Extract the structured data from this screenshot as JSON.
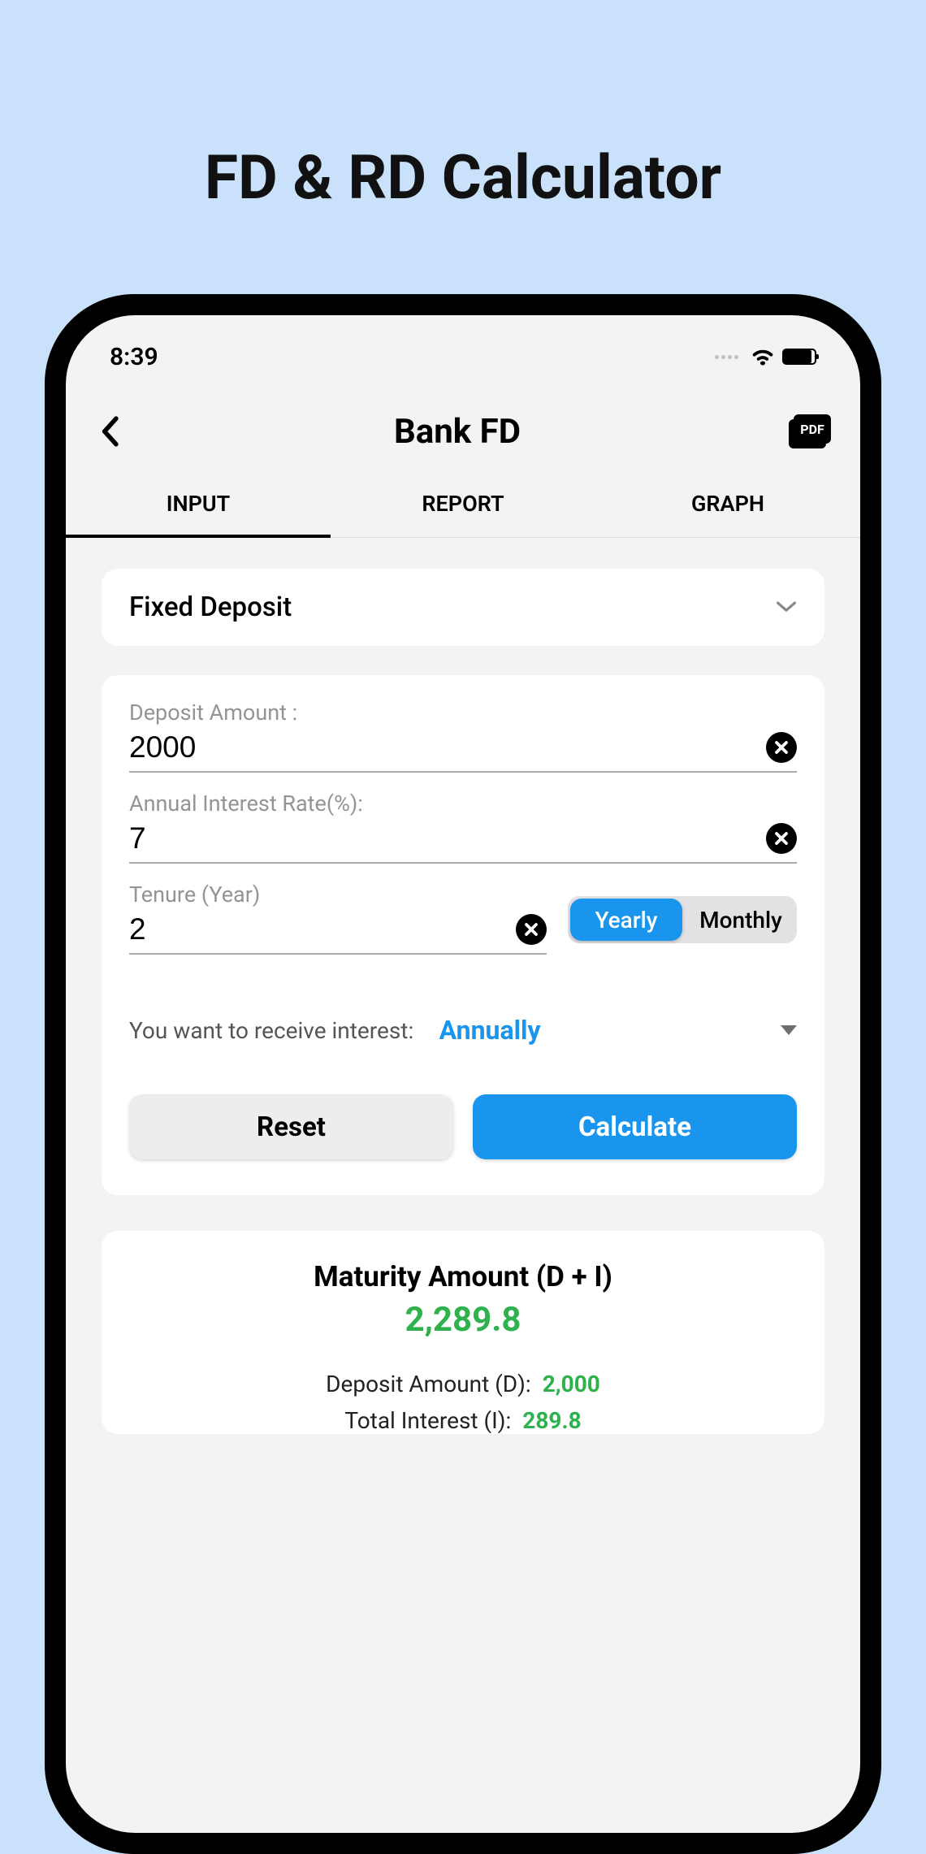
{
  "promo_title": "FD & RD Calculator",
  "status": {
    "time": "8:39"
  },
  "header": {
    "title": "Bank FD",
    "pdf": "PDF"
  },
  "tabs": {
    "input": "INPUT",
    "report": "REPORT",
    "graph": "GRAPH"
  },
  "selector": {
    "value": "Fixed Deposit"
  },
  "form": {
    "deposit_label": "Deposit Amount :",
    "deposit_value": "2000",
    "rate_label": "Annual Interest Rate(%):",
    "rate_value": "7",
    "tenure_label": "Tenure (Year)",
    "tenure_value": "2",
    "toggle_yearly": "Yearly",
    "toggle_monthly": "Monthly",
    "interest_label": "You want to receive interest:",
    "interest_value": "Annually",
    "reset": "Reset",
    "calculate": "Calculate"
  },
  "result": {
    "title": "Maturity Amount (D + I)",
    "value": "2,289.8",
    "deposit_label": "Deposit Amount (D):",
    "deposit_value": "2,000",
    "interest_label": "Total Interest (I):",
    "interest_value": "289.8"
  }
}
